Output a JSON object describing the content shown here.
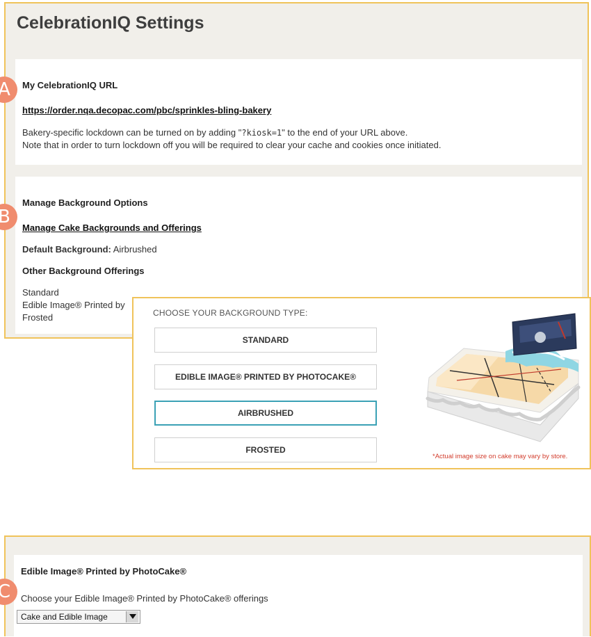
{
  "page_title": "CelebrationIQ Settings",
  "url_card": {
    "title": "My CelebrationIQ URL",
    "url": "https://order.nqa.decopac.com/pbc/sprinkles-bling-bakery",
    "note_prefix": "Bakery-specific lockdown can be turned on by adding \"",
    "note_code": "?kiosk=1",
    "note_suffix": "\" to the end of your URL above.",
    "note_line2": "Note that in order to turn lockdown off you will be required to clear your cache and cookies once initiated."
  },
  "background_card": {
    "title": "Manage Background Options",
    "manage_link": "Manage Cake Backgrounds and Offerings",
    "default_label": "Default Background:",
    "default_value": "Airbrushed",
    "other_title": "Other Background Offerings",
    "offerings": [
      "Standard",
      "Edible Image® Printed by",
      "Frosted"
    ]
  },
  "badges": [
    "A",
    "B",
    "C"
  ],
  "background_chooser": {
    "heading": "CHOOSE YOUR BACKGROUND TYPE:",
    "options": [
      "STANDARD",
      "EDIBLE IMAGE® PRINTED BY PHOTOCAKE®",
      "AIRBRUSHED",
      "FROSTED"
    ],
    "selected": "AIRBRUSHED",
    "disclaimer": "*Actual image size on cake may vary by store."
  },
  "edible_card": {
    "title": "Edible Image® Printed by PhotoCake®",
    "description": "Choose your Edible Image® Printed by PhotoCake® offerings",
    "select_value": "Cake and Edible Image"
  },
  "colors": {
    "panel_border": "#f0c35a",
    "panel_bg": "#f1efea",
    "badge": "#f08c6e",
    "selected_border": "#3aa1b5",
    "disclaimer": "#d23b2b"
  }
}
